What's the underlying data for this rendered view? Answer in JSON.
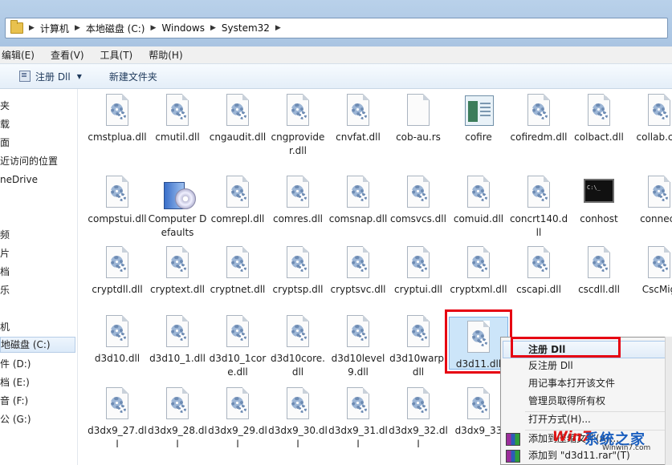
{
  "address_bar": {
    "crumbs": [
      "计算机",
      "本地磁盘 (C:)",
      "Windows",
      "System32"
    ]
  },
  "menubar": {
    "items": [
      "编辑(E)",
      "查看(V)",
      "工具(T)",
      "帮助(H)"
    ]
  },
  "toolbar": {
    "register_label": "注册 Dll",
    "new_folder_label": "新建文件夹"
  },
  "navpane": {
    "items": [
      "夹",
      "载",
      "面",
      "近访问的位置",
      "neDrive",
      "频",
      "片",
      "档",
      "乐",
      "机",
      "地磁盘 (C:)",
      "件 (D:)",
      "档 (E:)",
      "音 (F:)",
      "公 (G:)"
    ],
    "selected": "地磁盘 (C:)"
  },
  "files": [
    {
      "name": "cmstplua.dll",
      "type": "dll"
    },
    {
      "name": "cmutil.dll",
      "type": "dll"
    },
    {
      "name": "cngaudit.dll",
      "type": "dll"
    },
    {
      "name": "cngprovider.dll",
      "type": "dll"
    },
    {
      "name": "cnvfat.dll",
      "type": "dll"
    },
    {
      "name": "cob-au.rs",
      "type": "blank"
    },
    {
      "name": "cofire",
      "type": "cofire"
    },
    {
      "name": "cofiredm.dll",
      "type": "dll"
    },
    {
      "name": "colbact.dll",
      "type": "dll"
    },
    {
      "name": "collab.cpl",
      "type": "dll"
    },
    {
      "name": "compstui.dll",
      "type": "dll"
    },
    {
      "name": "Computer Defaults",
      "type": "setup"
    },
    {
      "name": "comrepl.dll",
      "type": "dll"
    },
    {
      "name": "comres.dll",
      "type": "dll"
    },
    {
      "name": "comsnap.dll",
      "type": "dll"
    },
    {
      "name": "comsvcs.dll",
      "type": "dll"
    },
    {
      "name": "comuid.dll",
      "type": "dll"
    },
    {
      "name": "concrt140.dll",
      "type": "dll"
    },
    {
      "name": "conhost",
      "type": "console"
    },
    {
      "name": "connect",
      "type": "dll"
    },
    {
      "name": "cryptdll.dll",
      "type": "dll"
    },
    {
      "name": "cryptext.dll",
      "type": "dll"
    },
    {
      "name": "cryptnet.dll",
      "type": "dll"
    },
    {
      "name": "cryptsp.dll",
      "type": "dll"
    },
    {
      "name": "cryptsvc.dll",
      "type": "dll"
    },
    {
      "name": "cryptui.dll",
      "type": "dll"
    },
    {
      "name": "cryptxml.dll",
      "type": "dll"
    },
    {
      "name": "cscapi.dll",
      "type": "dll"
    },
    {
      "name": "cscdll.dll",
      "type": "dll"
    },
    {
      "name": "CscMig",
      "type": "dll"
    },
    {
      "name": "d3d10.dll",
      "type": "dll"
    },
    {
      "name": "d3d10_1.dll",
      "type": "dll"
    },
    {
      "name": "d3d10_1core.dll",
      "type": "dll"
    },
    {
      "name": "d3d10core.dll",
      "type": "dll"
    },
    {
      "name": "d3d10level9.dll",
      "type": "dll"
    },
    {
      "name": "d3d10warp.dll",
      "type": "dll"
    },
    {
      "name": "d3d11.dll",
      "type": "dll",
      "selected": true
    },
    {
      "name": "d3dx9_27.dll",
      "type": "dll"
    },
    {
      "name": "d3dx9_28.dll",
      "type": "dll"
    },
    {
      "name": "d3dx9_29.dll",
      "type": "dll"
    },
    {
      "name": "d3dx9_30.dll",
      "type": "dll"
    },
    {
      "name": "d3dx9_31.dll",
      "type": "dll"
    },
    {
      "name": "d3dx9_32.dll",
      "type": "dll"
    },
    {
      "name": "d3dx9_33",
      "type": "dll"
    }
  ],
  "context_menu": {
    "items": [
      "注册 Dll",
      "反注册 Dll",
      "用记事本打开该文件",
      "管理员取得所有权",
      "打开方式(H)...",
      "添加到压缩文件(A)...",
      "添加到 \"d3d11.rar\"(T)"
    ]
  },
  "watermark": {
    "brand": "Win7",
    "text": "系统之家",
    "url": "Winwin7.com"
  }
}
